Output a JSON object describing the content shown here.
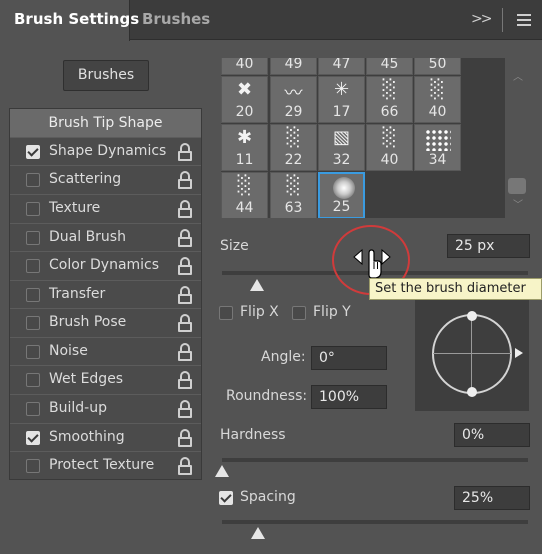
{
  "tabs": [
    {
      "label": "Brush Settings"
    },
    {
      "label": "Brushes"
    }
  ],
  "header": {
    "collapse_glyph": ">>"
  },
  "brushes_button": "Brushes",
  "brush_tip_shape": "Brush Tip Shape",
  "options": [
    {
      "label": "Shape Dynamics",
      "checked": true
    },
    {
      "label": "Scattering",
      "checked": false
    },
    {
      "label": "Texture",
      "checked": false
    },
    {
      "label": "Dual Brush",
      "checked": false
    },
    {
      "label": "Color Dynamics",
      "checked": false
    },
    {
      "label": "Transfer",
      "checked": false
    },
    {
      "label": "Brush Pose",
      "checked": false
    },
    {
      "label": "Noise",
      "checked": false
    },
    {
      "label": "Wet Edges",
      "checked": false
    },
    {
      "label": "Build-up",
      "checked": false
    },
    {
      "label": "Smoothing",
      "checked": true
    },
    {
      "label": "Protect Texture",
      "checked": false
    }
  ],
  "brush_presets": {
    "top_row": [
      "40",
      "49",
      "47",
      "45",
      "50"
    ],
    "rows": [
      [
        "20",
        "29",
        "17",
        "66",
        "40"
      ],
      [
        "11",
        "22",
        "32",
        "40",
        "34"
      ],
      [
        "44",
        "63",
        "25"
      ]
    ],
    "selected": "25"
  },
  "size": {
    "label": "Size",
    "value": "25 px",
    "tooltip": "Set the brush diameter"
  },
  "flip_x": {
    "label": "Flip X",
    "checked": false
  },
  "flip_y": {
    "label": "Flip Y",
    "checked": false
  },
  "angle": {
    "label": "Angle:",
    "value": "0°"
  },
  "roundness": {
    "label": "Roundness:",
    "value": "100%"
  },
  "hardness": {
    "label": "Hardness",
    "value": "0%"
  },
  "spacing": {
    "label": "Spacing",
    "value": "25%",
    "checked": true
  }
}
